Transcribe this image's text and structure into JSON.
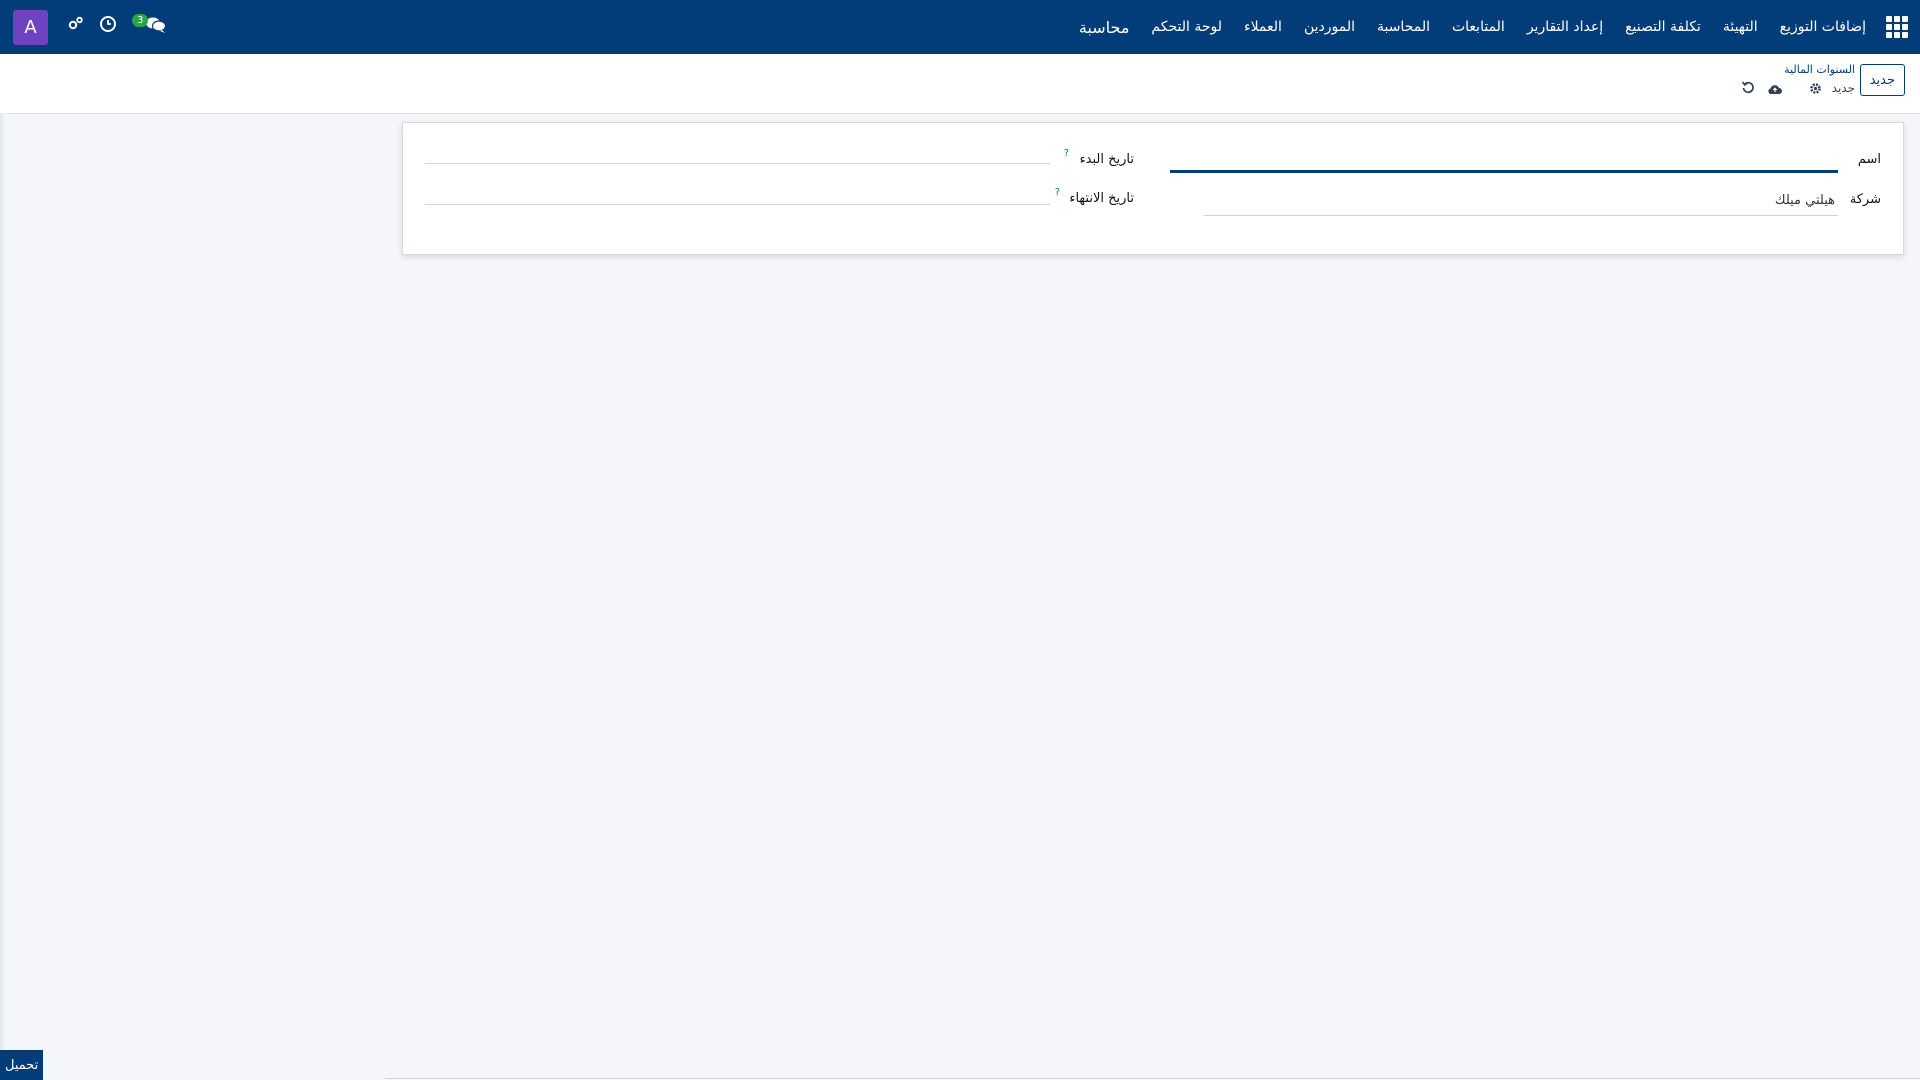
{
  "nav": {
    "brand": "محاسبة",
    "items": [
      "لوحة التحكم",
      "العملاء",
      "الموردين",
      "المحاسبة",
      "المتابعات",
      "إعداد التقارير",
      "تكلفة التصنيع",
      "التهيئة",
      "إضافات التوزيع"
    ],
    "chat_count": "3",
    "avatar_letter": "A"
  },
  "control_panel": {
    "new_label": "جديد",
    "breadcrumb_parent": "السنوات المالية",
    "breadcrumb_current": "جديد"
  },
  "form": {
    "name_label": "اسم",
    "company_label": "شركة",
    "company_value": "هيلتي ميلك",
    "start_date_label": "تاريخ البدء",
    "end_date_label": "تاريخ الانتهاء",
    "help_mark": "?"
  },
  "footer": {
    "load_label": "تحميل"
  },
  "colors": {
    "navbar": "#023d7a",
    "avatar": "#6f42c1",
    "badge": "#28a745",
    "background": "#f4f6fa"
  }
}
